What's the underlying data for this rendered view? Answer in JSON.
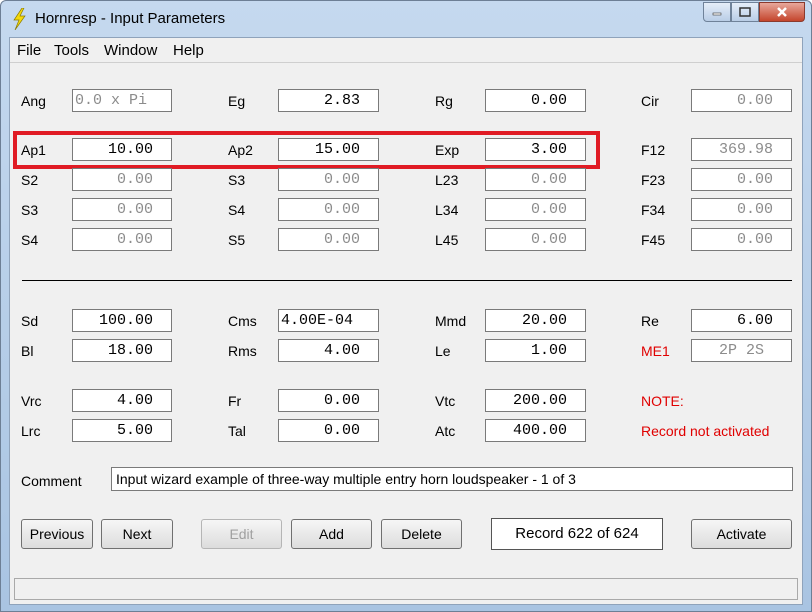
{
  "window": {
    "title": "Hornresp - Input Parameters"
  },
  "menu": {
    "file": "File",
    "tools": "Tools",
    "window": "Window",
    "help": "Help"
  },
  "params": {
    "ang": {
      "label": "Ang",
      "value": "0.0 x Pi"
    },
    "eg": {
      "label": "Eg",
      "value": "2.83"
    },
    "rg": {
      "label": "Rg",
      "value": "0.00"
    },
    "cir": {
      "label": "Cir",
      "value": "0.00"
    },
    "ap1": {
      "label": "Ap1",
      "value": "10.00"
    },
    "ap2": {
      "label": "Ap2",
      "value": "15.00"
    },
    "exp": {
      "label": "Exp",
      "value": "3.00"
    },
    "f12": {
      "label": "F12",
      "value": "369.98"
    },
    "s2": {
      "label": "S2",
      "value": "0.00"
    },
    "s3a": {
      "label": "S3",
      "value": "0.00"
    },
    "l23": {
      "label": "L23",
      "value": "0.00"
    },
    "f23": {
      "label": "F23",
      "value": "0.00"
    },
    "s3b": {
      "label": "S3",
      "value": "0.00"
    },
    "s4a": {
      "label": "S4",
      "value": "0.00"
    },
    "l34": {
      "label": "L34",
      "value": "0.00"
    },
    "f34": {
      "label": "F34",
      "value": "0.00"
    },
    "s4b": {
      "label": "S4",
      "value": "0.00"
    },
    "s5": {
      "label": "S5",
      "value": "0.00"
    },
    "l45": {
      "label": "L45",
      "value": "0.00"
    },
    "f45": {
      "label": "F45",
      "value": "0.00"
    },
    "sd": {
      "label": "Sd",
      "value": "100.00"
    },
    "cms": {
      "label": "Cms",
      "value": "4.00E-04"
    },
    "mmd": {
      "label": "Mmd",
      "value": "20.00"
    },
    "re": {
      "label": "Re",
      "value": "6.00"
    },
    "bl": {
      "label": "Bl",
      "value": "18.00"
    },
    "rms": {
      "label": "Rms",
      "value": "4.00"
    },
    "le": {
      "label": "Le",
      "value": "1.00"
    },
    "me1": {
      "label": "ME1",
      "value": "2P 2S"
    },
    "vrc": {
      "label": "Vrc",
      "value": "4.00"
    },
    "fr": {
      "label": "Fr",
      "value": "0.00"
    },
    "vtc": {
      "label": "Vtc",
      "value": "200.00"
    },
    "lrc": {
      "label": "Lrc",
      "value": "5.00"
    },
    "tal": {
      "label": "Tal",
      "value": "0.00"
    },
    "atc": {
      "label": "Atc",
      "value": "400.00"
    }
  },
  "note": {
    "label": "NOTE:",
    "text": "Record not activated"
  },
  "comment": {
    "label": "Comment",
    "value": "Input wizard example of three-way multiple entry horn loudspeaker  -  1 of 3"
  },
  "buttons": {
    "previous": "Previous",
    "next": "Next",
    "edit": "Edit",
    "add": "Add",
    "delete": "Delete",
    "activate": "Activate"
  },
  "record": {
    "text": "Record 622 of 624"
  },
  "colors": {
    "highlight": "#e01b24",
    "note": "#e00000"
  }
}
